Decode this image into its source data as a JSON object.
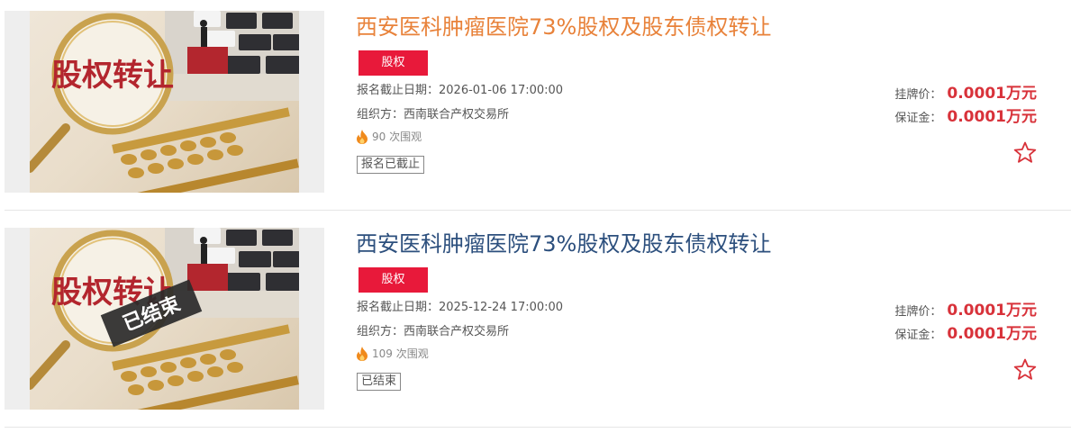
{
  "listings": [
    {
      "title": "西安医科肿瘤医院73%股权及股东债权转让",
      "title_color": "#e8823a",
      "tag": "股权",
      "image_text": "股权转让",
      "deadline": "报名截止日期：2026-01-06 17:00:00",
      "organizer": "组织方：西南联合产权交易所",
      "views": "90 次围观",
      "status": "报名已截止",
      "listing_price_label": "挂牌价：",
      "listing_price": "0.0001万元",
      "deposit_label": "保证金：",
      "deposit": "0.0001万元",
      "ended_ribbon": ""
    },
    {
      "title": "西安医科肿瘤医院73%股权及股东债权转让",
      "title_color": "#2c4f7d",
      "tag": "股权",
      "image_text": "股权转让",
      "deadline": "报名截止日期：2025-12-24 17:00:00",
      "organizer": "组织方：西南联合产权交易所",
      "views": "109 次围观",
      "status": "已结束",
      "listing_price_label": "挂牌价：",
      "listing_price": "0.0001万元",
      "deposit_label": "保证金：",
      "deposit": "0.0001万元",
      "ended_ribbon": "已结束"
    }
  ],
  "colors": {
    "accent_red": "#e8193a",
    "price_red": "#d8323a",
    "star_red": "#d8323a"
  },
  "icons": [
    "fire-icon",
    "star-icon"
  ]
}
